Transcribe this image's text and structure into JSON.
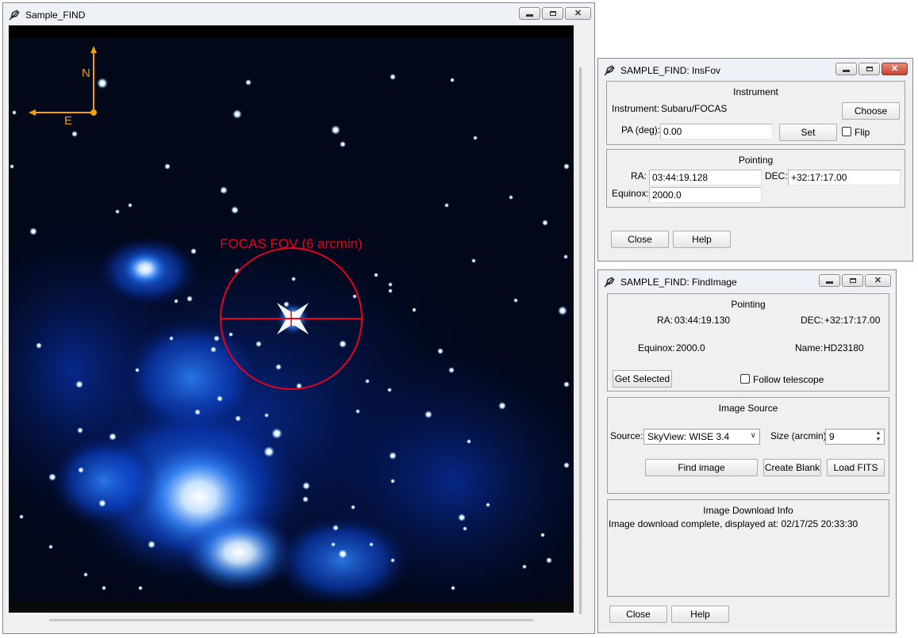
{
  "find_window": {
    "title": "Sample_FIND",
    "compass": {
      "north": "N",
      "east": "E"
    },
    "fov_label": "FOCAS FOV (6 arcmin)",
    "colors": {
      "compass": "#f0a000",
      "fov": "#e8001e"
    }
  },
  "insfov": {
    "title": "SAMPLE_FIND: InsFov",
    "instrument_group": {
      "title": "Instrument",
      "instrument_label": "Instrument:",
      "instrument_value": "Subaru/FOCAS",
      "choose_button": "Choose",
      "pa_label": "PA (deg):",
      "pa_value": "0.00",
      "set_button": "Set",
      "flip_label": "Flip",
      "flip_checked": false
    },
    "pointing_group": {
      "title": "Pointing",
      "ra_label": "RA:",
      "ra_value": "03:44:19.128",
      "dec_label": "DEC:",
      "dec_value": "+32:17:17.00",
      "equinox_label": "Equinox:",
      "equinox_value": "2000.0"
    },
    "close_button": "Close",
    "help_button": "Help"
  },
  "findimage": {
    "title": "SAMPLE_FIND: FindImage",
    "pointing_group": {
      "title": "Pointing",
      "ra_label": "RA:",
      "ra_value": "03:44:19.130",
      "dec_label": "DEC:",
      "dec_value": "+32:17:17.00",
      "equinox_label": "Equinox:",
      "equinox_value": "2000.0",
      "name_label": "Name:",
      "name_value": "HD23180",
      "get_selected_button": "Get Selected",
      "follow_label": "Follow telescope",
      "follow_checked": false
    },
    "source_group": {
      "title": "Image Source",
      "source_label": "Source:",
      "source_value": "SkyView: WISE 3.4",
      "size_label": "Size (arcmin):",
      "size_value": "9",
      "find_button": "Find image",
      "create_button": "Create Blank",
      "load_button": "Load FITS"
    },
    "download_group": {
      "title": "Image Download Info",
      "message": "Image download complete, displayed at: 02/17/25 20:33:30"
    },
    "close_button": "Close",
    "help_button": "Help"
  }
}
